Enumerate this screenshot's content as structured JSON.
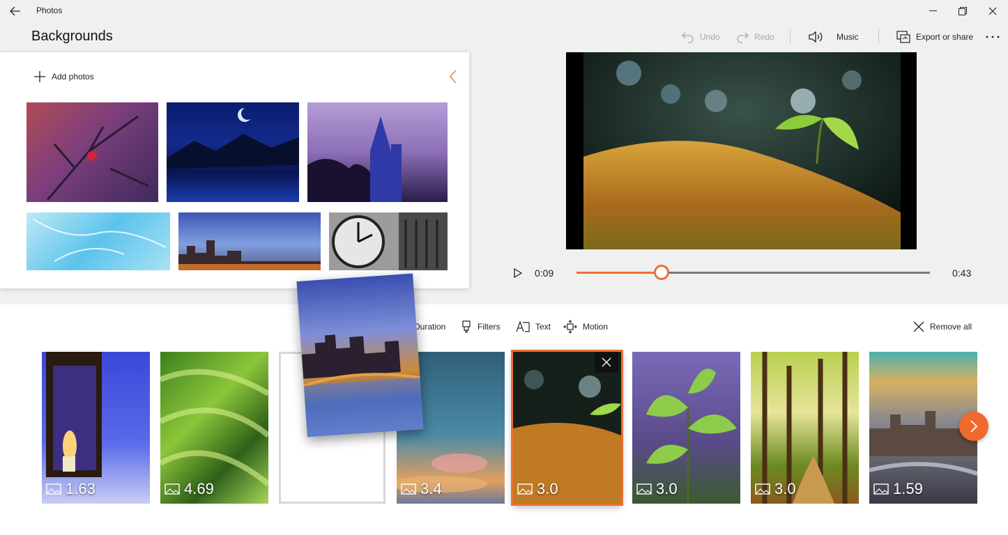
{
  "app": {
    "title": "Photos",
    "page_title": "Backgrounds"
  },
  "window": {
    "back_icon": "back-arrow-icon",
    "minimize_icon": "minimize-icon",
    "restore_icon": "restore-icon",
    "close_icon": "close-icon"
  },
  "toolbar": {
    "undo_label": "Undo",
    "redo_label": "Redo",
    "music_label": "Music",
    "export_label": "Export or share",
    "more_icon": "more-icon"
  },
  "library": {
    "add_label": "Add photos",
    "photos": [
      "berry-branch",
      "moonlit-lake",
      "castle-at-dusk",
      "ice-crystals",
      "city-skyline",
      "clock-tower"
    ]
  },
  "player": {
    "current_time": "0:09",
    "total_time": "0:43",
    "progress": 0.24
  },
  "storyboard_tools": {
    "duration_label": "Duration",
    "filters_label": "Filters",
    "text_label": "Text",
    "motion_label": "Motion",
    "remove_all_label": "Remove all"
  },
  "storyboard": {
    "cards": [
      {
        "duration": "1.63",
        "scene": "candle-lantern"
      },
      {
        "duration": "4.69",
        "scene": "green-texture"
      },
      {
        "duration": "3.4",
        "scene": "sunset-clouds"
      },
      {
        "duration": "3.0",
        "scene": "moss-sprout",
        "selected": true
      },
      {
        "duration": "3.0",
        "scene": "green-leaves"
      },
      {
        "duration": "3.0",
        "scene": "forest-path"
      },
      {
        "duration": "1.59",
        "scene": "london-aerial"
      }
    ]
  },
  "colors": {
    "accent": "#ec6f33",
    "next_button": "#ef6a2c"
  }
}
